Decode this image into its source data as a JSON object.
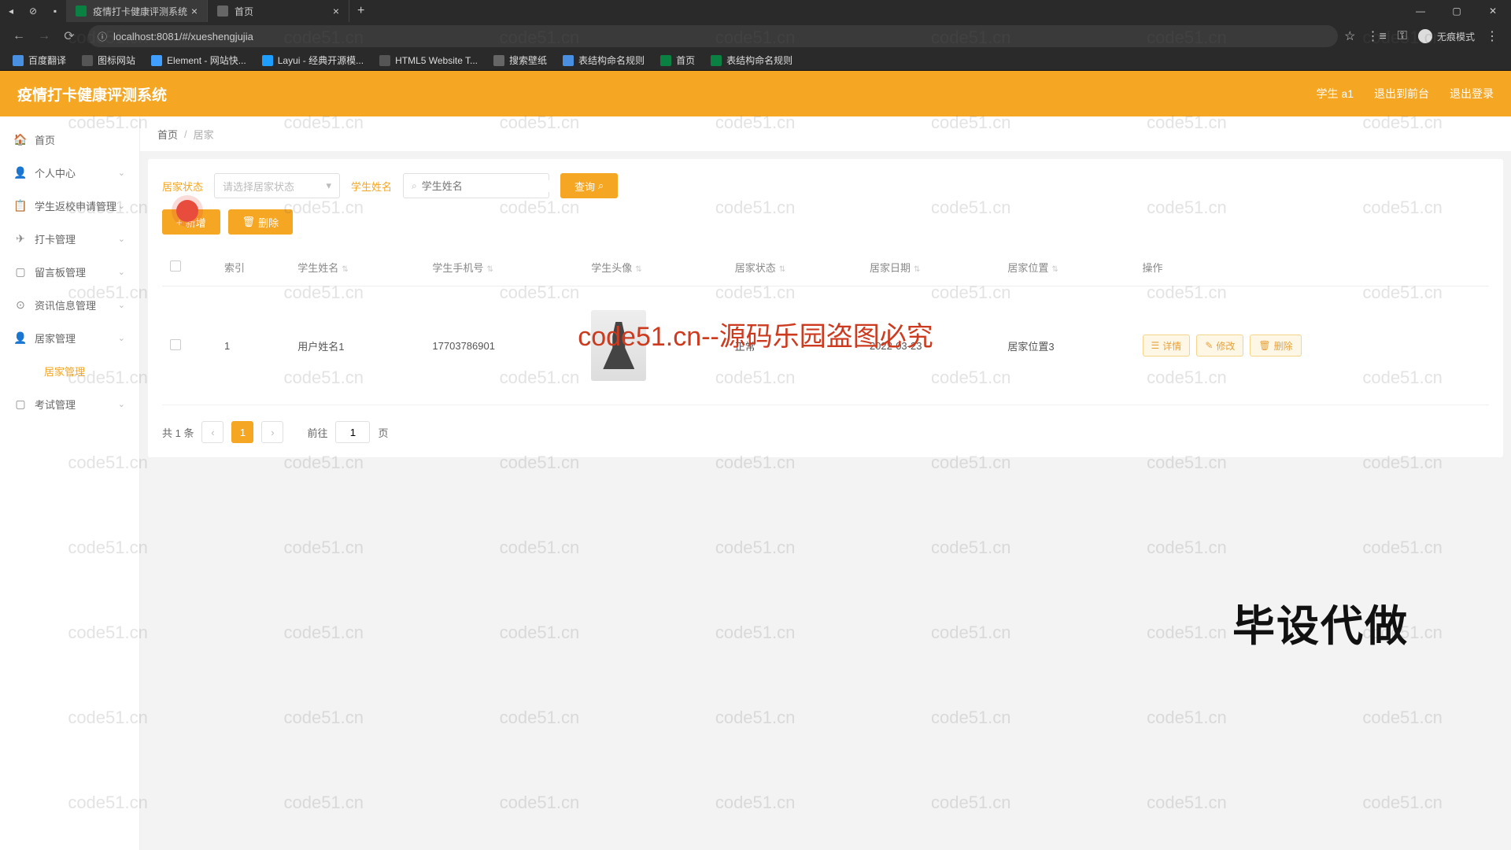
{
  "browser": {
    "tabs": [
      {
        "title": "疫情打卡健康评测系统",
        "active": true
      },
      {
        "title": "首页",
        "active": false
      }
    ],
    "url": "localhost:8081/#/xueshengjujia",
    "incognito_label": "无痕模式",
    "bookmarks": [
      {
        "label": "百度翻译",
        "cls": ""
      },
      {
        "label": "图标网站",
        "cls": "f"
      },
      {
        "label": "Element - 网站快...",
        "cls": "e"
      },
      {
        "label": "Layui - 经典开源模...",
        "cls": "l"
      },
      {
        "label": "HTML5 Website T...",
        "cls": "h"
      },
      {
        "label": "搜索壁纸",
        "cls": "s"
      },
      {
        "label": "表结构命名规则",
        "cls": ""
      },
      {
        "label": "首页",
        "cls": "g"
      },
      {
        "label": "表结构命名规则",
        "cls": "g"
      }
    ]
  },
  "header": {
    "title": "疫情打卡健康评测系统",
    "user": "学生 a1",
    "back_front": "退出到前台",
    "logout": "退出登录"
  },
  "sidebar": {
    "items": [
      {
        "icon": "🏠",
        "label": "首页",
        "has_children": false
      },
      {
        "icon": "👤",
        "label": "个人中心",
        "has_children": true
      },
      {
        "icon": "📋",
        "label": "学生返校申请管理",
        "has_children": true
      },
      {
        "icon": "✈",
        "label": "打卡管理",
        "has_children": true
      },
      {
        "icon": "▢",
        "label": "留言板管理",
        "has_children": true
      },
      {
        "icon": "⊙",
        "label": "资讯信息管理",
        "has_children": true
      },
      {
        "icon": "👤",
        "label": "居家管理",
        "has_children": true
      },
      {
        "icon": "",
        "label": "居家管理",
        "has_children": false,
        "active": true,
        "child": true
      },
      {
        "icon": "▢",
        "label": "考试管理",
        "has_children": true
      }
    ]
  },
  "breadcrumb": {
    "home": "首页",
    "separator": "/",
    "current": "居家"
  },
  "filters": {
    "status_label": "居家状态",
    "status_placeholder": "请选择居家状态",
    "name_label": "学生姓名",
    "name_placeholder": "学生姓名",
    "query_btn": "查询"
  },
  "actions": {
    "add": "新增",
    "delete": "删除"
  },
  "table": {
    "headers": [
      "索引",
      "学生姓名",
      "学生手机号",
      "学生头像",
      "居家状态",
      "居家日期",
      "居家位置",
      "操作"
    ],
    "rows": [
      {
        "index": "1",
        "name": "用户姓名1",
        "phone": "17703786901",
        "status": "正常",
        "date": "2022-03-23",
        "location": "居家位置3"
      }
    ],
    "row_actions": {
      "detail": "详情",
      "edit": "修改",
      "delete": "删除"
    }
  },
  "pagination": {
    "total_text": "共 1 条",
    "current": "1",
    "goto_prefix": "前往",
    "goto_value": "1",
    "goto_suffix": "页"
  },
  "watermark": {
    "text": "code51.cn",
    "big": "code51.cn--源码乐园盗图必究",
    "corner": "毕设代做"
  }
}
